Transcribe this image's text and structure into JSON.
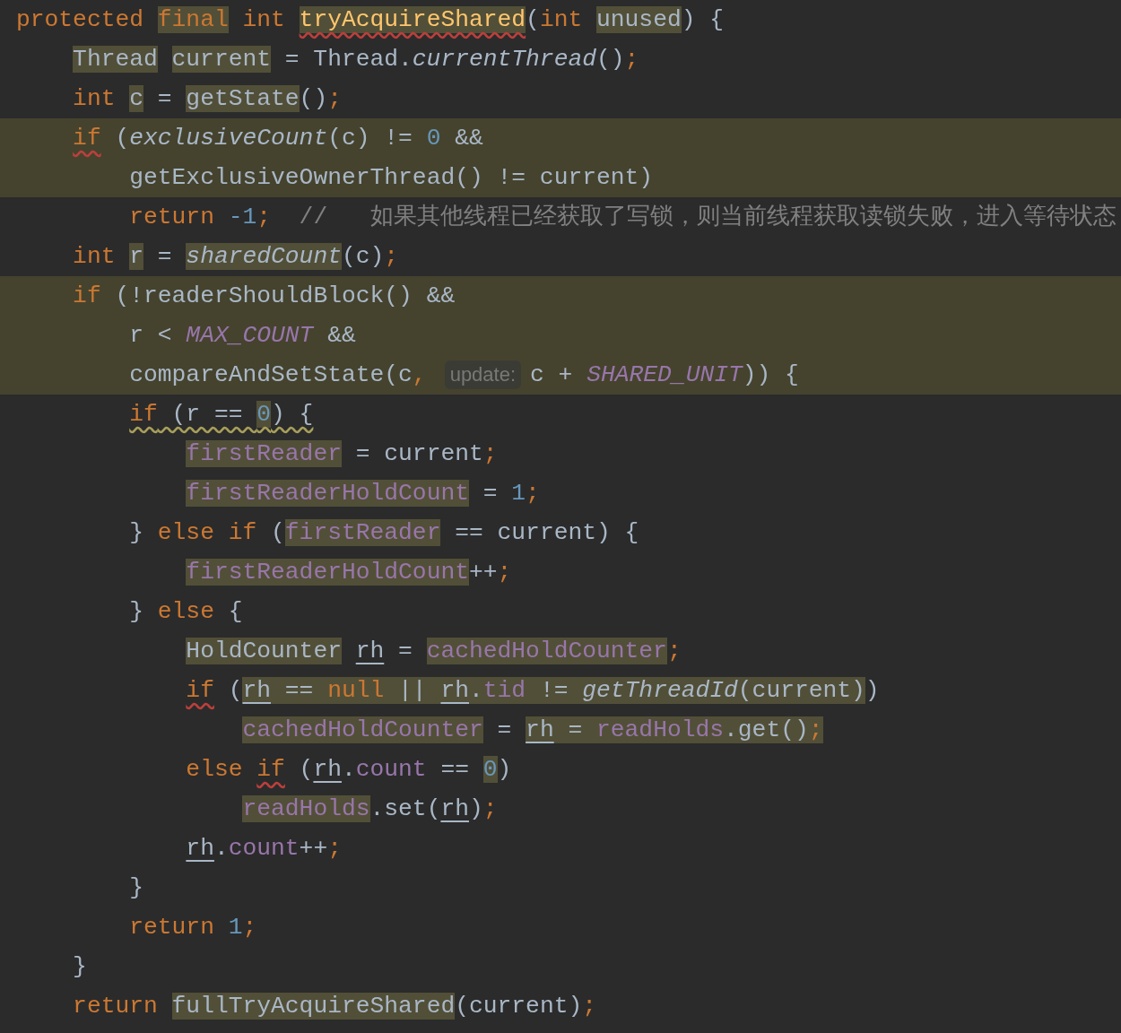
{
  "editor": {
    "lines": [
      {
        "band": false,
        "tokens": [
          {
            "text": "protected ",
            "kind": "keyword",
            "highlighted": false
          },
          {
            "text": "final",
            "kind": "keyword",
            "highlighted": true,
            "spaced": true
          },
          {
            "text": "int ",
            "kind": "keyword",
            "highlighted": false
          },
          {
            "text": "tryAcquireShared",
            "kind": "declaration",
            "highlighted": true,
            "error_underline": true
          },
          {
            "text": "(",
            "kind": "plain",
            "highlighted": false
          },
          {
            "text": "int ",
            "kind": "keyword",
            "highlighted": false
          },
          {
            "text": "unused",
            "kind": "plain",
            "highlighted": true
          },
          {
            "text": ") {",
            "kind": "plain",
            "highlighted": false
          }
        ],
        "children": [
          {
            "band": false,
            "tokens": [
              {
                "text": "Thread",
                "kind": "plain",
                "highlighted": true,
                "spaced": true
              },
              {
                "text": "current",
                "kind": "plain",
                "highlighted": true
              },
              {
                "text": " = Thread.",
                "kind": "plain",
                "highlighted": false
              },
              {
                "text": "currentThread",
                "kind": "call",
                "highlighted": false
              },
              {
                "text": "()",
                "kind": "plain",
                "highlighted": false
              },
              {
                "text": ";",
                "kind": "keyword",
                "highlighted": false
              }
            ]
          },
          {
            "band": false,
            "tokens": [
              {
                "text": "int ",
                "kind": "keyword",
                "highlighted": false
              },
              {
                "text": "c",
                "kind": "plain",
                "highlighted": true
              },
              {
                "text": " = ",
                "kind": "plain",
                "highlighted": false
              },
              {
                "text": "getState",
                "kind": "plain",
                "highlighted": true
              },
              {
                "text": "()",
                "kind": "plain",
                "highlighted": false
              },
              {
                "text": ";",
                "kind": "keyword",
                "highlighted": false
              }
            ]
          },
          {
            "band": true,
            "tokens": [
              {
                "text": "if",
                "kind": "keyword",
                "highlighted": false,
                "error_underline": true
              },
              {
                "text": " (",
                "kind": "plain",
                "highlighted": false
              },
              {
                "text": "exclusiveCount",
                "kind": "call",
                "highlighted": false
              },
              {
                "text": "(c) != ",
                "kind": "plain",
                "highlighted": false
              },
              {
                "text": "0",
                "kind": "number",
                "highlighted": false
              },
              {
                "text": " &&",
                "kind": "plain",
                "highlighted": false
              }
            ],
            "children": [
              {
                "band": true,
                "tokens": [
                  {
                    "text": "getExclusiveOwnerThread() != current",
                    "kind": "plain",
                    "highlighted": false
                  },
                  {
                    "text": ")",
                    "kind": "plain",
                    "highlighted": false
                  }
                ]
              },
              {
                "band": false,
                "tokens": [
                  {
                    "text": "return ",
                    "kind": "keyword",
                    "highlighted": false
                  },
                  {
                    "text": "-1",
                    "kind": "number",
                    "highlighted": false
                  },
                  {
                    "text": ";",
                    "kind": "keyword",
                    "highlighted": false
                  },
                  {
                    "text": "  //   如果其他线程已经获取了写锁，则当前线程获取读锁失败，进入等待状态",
                    "kind": "comment",
                    "highlighted": false
                  }
                ]
              }
            ]
          },
          {
            "band": false,
            "tokens": [
              {
                "text": "int ",
                "kind": "keyword",
                "highlighted": false
              },
              {
                "text": "r",
                "kind": "plain",
                "highlighted": true
              },
              {
                "text": " = ",
                "kind": "plain",
                "highlighted": false
              },
              {
                "text": "sharedCount",
                "kind": "call",
                "highlighted": true
              },
              {
                "text": "(c)",
                "kind": "plain",
                "highlighted": false
              },
              {
                "text": ";",
                "kind": "keyword",
                "highlighted": false
              }
            ]
          },
          {
            "band": true,
            "tokens": [
              {
                "text": "if",
                "kind": "keyword",
                "highlighted": false
              },
              {
                "text": " (!readerShouldBlock() &&",
                "kind": "plain",
                "highlighted": false
              }
            ],
            "children": [
              {
                "band": true,
                "tokens": [
                  {
                    "text": "r < ",
                    "kind": "plain",
                    "highlighted": false
                  },
                  {
                    "text": "MAX_COUNT",
                    "kind": "constant",
                    "highlighted": false
                  },
                  {
                    "text": " &&",
                    "kind": "plain",
                    "highlighted": false
                  }
                ]
              },
              {
                "band": true,
                "tokens": [
                  {
                    "text": "compareAndSetState(c",
                    "kind": "plain",
                    "highlighted": false
                  },
                  {
                    "text": ",",
                    "kind": "keyword",
                    "highlighted": false
                  },
                  {
                    "text": "update:",
                    "kind": "hint"
                  },
                  {
                    "text": "c + ",
                    "kind": "plain",
                    "highlighted": false
                  },
                  {
                    "text": "SHARED_UNIT",
                    "kind": "constant",
                    "highlighted": false
                  },
                  {
                    "text": ")",
                    "kind": "plain",
                    "highlighted": false
                  },
                  {
                    "text": ") {",
                    "kind": "plain",
                    "highlighted": false
                  }
                ]
              },
              {
                "band": false,
                "tokens": [
                  {
                    "text": "if",
                    "kind": "keyword",
                    "highlighted": false,
                    "warning_underline": true
                  },
                  {
                    "text": " (r == ",
                    "kind": "plain",
                    "highlighted": false,
                    "warning_underline": true
                  },
                  {
                    "text": "0",
                    "kind": "number",
                    "highlighted": true,
                    "warning_underline": true
                  },
                  {
                    "text": ") {",
                    "kind": "plain",
                    "highlighted": false,
                    "warning_underline": true
                  }
                ],
                "children": [
                  {
                    "band": false,
                    "tokens": [
                      {
                        "text": "firstReader",
                        "kind": "field",
                        "highlighted": true
                      },
                      {
                        "text": " = current",
                        "kind": "plain",
                        "highlighted": false
                      },
                      {
                        "text": ";",
                        "kind": "keyword",
                        "highlighted": false
                      }
                    ]
                  },
                  {
                    "band": false,
                    "tokens": [
                      {
                        "text": "firstReaderHoldCount",
                        "kind": "field",
                        "highlighted": true
                      },
                      {
                        "text": " = ",
                        "kind": "plain",
                        "highlighted": false
                      },
                      {
                        "text": "1",
                        "kind": "number",
                        "highlighted": false
                      },
                      {
                        "text": ";",
                        "kind": "keyword",
                        "highlighted": false
                      }
                    ]
                  }
                ]
              },
              {
                "band": false,
                "tokens": [
                  {
                    "text": "} ",
                    "kind": "plain",
                    "highlighted": false
                  },
                  {
                    "text": "else ",
                    "kind": "keyword",
                    "highlighted": false
                  },
                  {
                    "text": "if",
                    "kind": "keyword",
                    "highlighted": false
                  },
                  {
                    "text": " (",
                    "kind": "plain",
                    "highlighted": false
                  },
                  {
                    "text": "firstReader",
                    "kind": "field",
                    "highlighted": true
                  },
                  {
                    "text": " == current) {",
                    "kind": "plain",
                    "highlighted": false
                  }
                ],
                "children": [
                  {
                    "band": false,
                    "tokens": [
                      {
                        "text": "firstReaderHoldCount",
                        "kind": "field",
                        "highlighted": true
                      },
                      {
                        "text": "++",
                        "kind": "plain",
                        "highlighted": false
                      },
                      {
                        "text": ";",
                        "kind": "keyword",
                        "highlighted": false
                      }
                    ]
                  }
                ]
              },
              {
                "band": false,
                "tokens": [
                  {
                    "text": "} ",
                    "kind": "plain",
                    "highlighted": false
                  },
                  {
                    "text": "else",
                    "kind": "keyword",
                    "highlighted": false
                  },
                  {
                    "text": " {",
                    "kind": "plain",
                    "highlighted": false
                  }
                ],
                "children": [
                  {
                    "band": false,
                    "tokens": [
                      {
                        "text": "HoldCounter",
                        "kind": "plain",
                        "highlighted": true,
                        "spaced": true
                      },
                      {
                        "text": "rh",
                        "kind": "plain",
                        "highlighted": false,
                        "usage_underline": true
                      },
                      {
                        "text": " = ",
                        "kind": "plain",
                        "highlighted": false
                      },
                      {
                        "text": "cachedHoldCounter",
                        "kind": "field",
                        "highlighted": true
                      },
                      {
                        "text": ";",
                        "kind": "keyword",
                        "highlighted": false
                      }
                    ]
                  },
                  {
                    "band": false,
                    "tokens": [
                      {
                        "text": "if",
                        "kind": "keyword",
                        "highlighted": false,
                        "error_underline": true
                      },
                      {
                        "text": " (",
                        "kind": "plain",
                        "highlighted": false
                      },
                      {
                        "text": "rh",
                        "kind": "plain",
                        "highlighted": true,
                        "usage_underline": true
                      },
                      {
                        "text": " == ",
                        "kind": "plain",
                        "highlighted": true
                      },
                      {
                        "text": "null",
                        "kind": "keyword",
                        "highlighted": true
                      },
                      {
                        "text": " || ",
                        "kind": "plain",
                        "highlighted": true
                      },
                      {
                        "text": "rh",
                        "kind": "plain",
                        "highlighted": true,
                        "usage_underline": true
                      },
                      {
                        "text": ".",
                        "kind": "plain",
                        "highlighted": true
                      },
                      {
                        "text": "tid",
                        "kind": "field",
                        "highlighted": true
                      },
                      {
                        "text": " != ",
                        "kind": "plain",
                        "highlighted": true
                      },
                      {
                        "text": "getThreadId",
                        "kind": "call",
                        "highlighted": true
                      },
                      {
                        "text": "(current)",
                        "kind": "plain",
                        "highlighted": true
                      },
                      {
                        "text": ")",
                        "kind": "plain",
                        "highlighted": false
                      }
                    ],
                    "children": [
                      {
                        "band": false,
                        "tokens": [
                          {
                            "text": "cachedHoldCounter",
                            "kind": "field",
                            "highlighted": true
                          },
                          {
                            "text": " = ",
                            "kind": "plain",
                            "highlighted": false
                          },
                          {
                            "text": "rh",
                            "kind": "plain",
                            "highlighted": true,
                            "usage_underline": true
                          },
                          {
                            "text": " = ",
                            "kind": "plain",
                            "highlighted": true
                          },
                          {
                            "text": "readHolds",
                            "kind": "field",
                            "highlighted": true
                          },
                          {
                            "text": ".get()",
                            "kind": "plain",
                            "highlighted": true
                          },
                          {
                            "text": ";",
                            "kind": "keyword",
                            "highlighted": true
                          }
                        ]
                      }
                    ]
                  },
                  {
                    "band": false,
                    "tokens": [
                      {
                        "text": "else ",
                        "kind": "keyword",
                        "highlighted": false
                      },
                      {
                        "text": "if",
                        "kind": "keyword",
                        "highlighted": false,
                        "error_underline": true
                      },
                      {
                        "text": " (",
                        "kind": "plain",
                        "highlighted": false
                      },
                      {
                        "text": "rh",
                        "kind": "plain",
                        "highlighted": false,
                        "usage_underline": true
                      },
                      {
                        "text": ".",
                        "kind": "plain",
                        "highlighted": false
                      },
                      {
                        "text": "count",
                        "kind": "field",
                        "highlighted": false
                      },
                      {
                        "text": " == ",
                        "kind": "plain",
                        "highlighted": false
                      },
                      {
                        "text": "0",
                        "kind": "number",
                        "highlighted": true
                      },
                      {
                        "text": ")",
                        "kind": "plain",
                        "highlighted": false
                      }
                    ],
                    "children": [
                      {
                        "band": false,
                        "tokens": [
                          {
                            "text": "readHolds",
                            "kind": "field",
                            "highlighted": true
                          },
                          {
                            "text": ".set(",
                            "kind": "plain",
                            "highlighted": false
                          },
                          {
                            "text": "rh",
                            "kind": "plain",
                            "highlighted": false,
                            "usage_underline": true
                          },
                          {
                            "text": ")",
                            "kind": "plain",
                            "highlighted": false
                          },
                          {
                            "text": ";",
                            "kind": "keyword",
                            "highlighted": false
                          }
                        ]
                      }
                    ]
                  },
                  {
                    "band": false,
                    "tokens": [
                      {
                        "text": "rh",
                        "kind": "plain",
                        "highlighted": false,
                        "usage_underline": true
                      },
                      {
                        "text": ".",
                        "kind": "plain",
                        "highlighted": false
                      },
                      {
                        "text": "count",
                        "kind": "field",
                        "highlighted": false
                      },
                      {
                        "text": "++",
                        "kind": "plain",
                        "highlighted": false
                      },
                      {
                        "text": ";",
                        "kind": "keyword",
                        "highlighted": false
                      }
                    ]
                  }
                ]
              },
              {
                "band": false,
                "tokens": [
                  {
                    "text": "}",
                    "kind": "plain",
                    "highlighted": false
                  }
                ]
              },
              {
                "band": false,
                "tokens": [
                  {
                    "text": "return ",
                    "kind": "keyword",
                    "highlighted": false
                  },
                  {
                    "text": "1",
                    "kind": "number",
                    "highlighted": false
                  },
                  {
                    "text": ";",
                    "kind": "keyword",
                    "highlighted": false
                  }
                ]
              }
            ]
          },
          {
            "band": false,
            "tokens": [
              {
                "text": "}",
                "kind": "plain",
                "highlighted": false
              }
            ]
          },
          {
            "band": false,
            "tokens": [
              {
                "text": "return ",
                "kind": "keyword",
                "highlighted": false
              },
              {
                "text": "fullTryAcquireShared",
                "kind": "plain",
                "highlighted": true
              },
              {
                "text": "(current)",
                "kind": "plain",
                "highlighted": false
              },
              {
                "text": ";",
                "kind": "keyword",
                "highlighted": false
              }
            ]
          }
        ]
      }
    ]
  }
}
